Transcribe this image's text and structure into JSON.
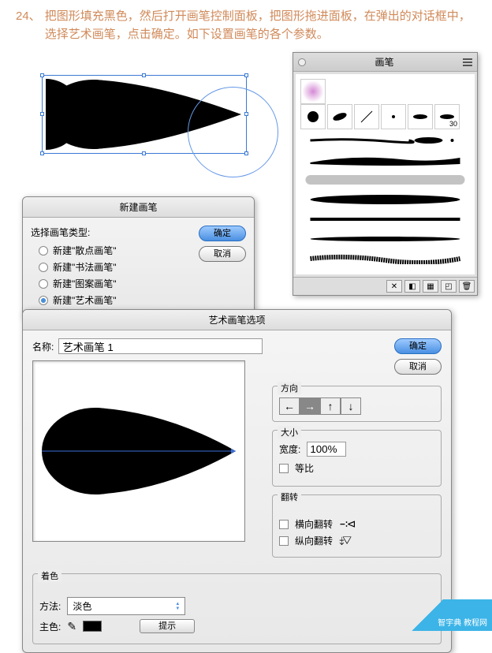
{
  "step": {
    "number": "24、",
    "text": "把图形填充黑色，然后打开画笔控制面板，把图形拖进面板，在弹出的对话框中，选择艺术画笔，点击确定。如下设置画笔的各个参数。"
  },
  "brushPanel": {
    "title": "画笔",
    "thumbSize": "30"
  },
  "newBrushDialog": {
    "title": "新建画笔",
    "groupLabel": "选择画笔类型:",
    "options": [
      {
        "label": "新建\"散点画笔\"",
        "checked": false
      },
      {
        "label": "新建\"书法画笔\"",
        "checked": false
      },
      {
        "label": "新建\"图案画笔\"",
        "checked": false
      },
      {
        "label": "新建\"艺术画笔\"",
        "checked": true
      }
    ],
    "ok": "确定",
    "cancel": "取消"
  },
  "optionsDialog": {
    "title": "艺术画笔选项",
    "nameLabel": "名称:",
    "nameValue": "艺术画笔 1",
    "ok": "确定",
    "cancel": "取消",
    "direction": {
      "label": "方向",
      "buttons": [
        "←",
        "→",
        "↑",
        "↓"
      ],
      "activeIndex": 1
    },
    "size": {
      "label": "大小",
      "widthLabel": "宽度:",
      "widthValue": "100%",
      "proportional": "等比"
    },
    "flip": {
      "label": "翻转",
      "horizontal": "横向翻转",
      "vertical": "纵向翻转"
    },
    "tint": {
      "label": "着色",
      "methodLabel": "方法:",
      "methodValue": "淡色",
      "keyColorLabel": "主色:",
      "tipButton": "提示"
    }
  },
  "watermark": "智宇典 教程网"
}
